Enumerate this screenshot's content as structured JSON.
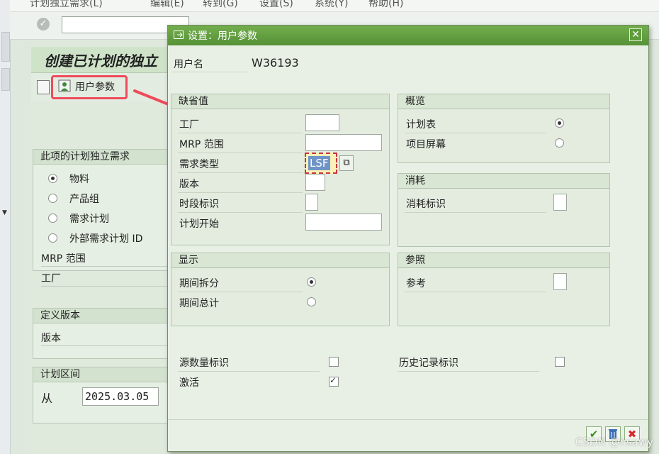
{
  "menu": [
    "计划独立需求(L)",
    "编辑(E)",
    "转到(G)",
    "设置(S)",
    "系统(Y)",
    "帮助(H)"
  ],
  "background": {
    "title": "创建已计划的独立",
    "user_params_label": "用户参数",
    "independent_req_group": {
      "title": "此项的计划独立需求",
      "options": [
        "物料",
        "产品组",
        "需求计划",
        "外部需求计划 ID"
      ],
      "selected_index": 0
    },
    "mrp_area_label": "MRP 范围",
    "plant_label": "工厂",
    "version_group": {
      "title": "定义版本",
      "version_label": "版本"
    },
    "period_group": {
      "title": "计划区间",
      "from_label": "从",
      "from_value": "2025.03.05"
    }
  },
  "dialog": {
    "title": "设置：用户参数",
    "username_label": "用户名",
    "username_value": "W36193",
    "defaults_group": {
      "title": "缺省值",
      "plant_label": "工厂",
      "mrp_area_label": "MRP 范围",
      "req_type_label": "需求类型",
      "req_type_value": "LSF",
      "version_label": "版本",
      "period_indicator_label": "时段标识",
      "planning_start_label": "计划开始"
    },
    "overview_group": {
      "title": "概览",
      "options": [
        "计划表",
        "项目屏幕"
      ],
      "selected_index": 0
    },
    "consumption_group": {
      "title": "消耗",
      "consumption_indicator_label": "消耗标识"
    },
    "display_group": {
      "title": "显示",
      "options": [
        "期间拆分",
        "期间总计"
      ],
      "selected_index": 0
    },
    "reference_group": {
      "title": "参照",
      "reference_label": "参考"
    },
    "source_qty_indicator_label": "源数量标识",
    "source_qty_indicator_checked": false,
    "history_indicator_label": "历史记录标识",
    "history_indicator_checked": false,
    "activate_label": "激活",
    "activate_checked": true
  },
  "watermark": "CSDN @hsawy",
  "colors": {
    "accent_green": "#559236",
    "highlight_red": "#ee4b5b"
  }
}
